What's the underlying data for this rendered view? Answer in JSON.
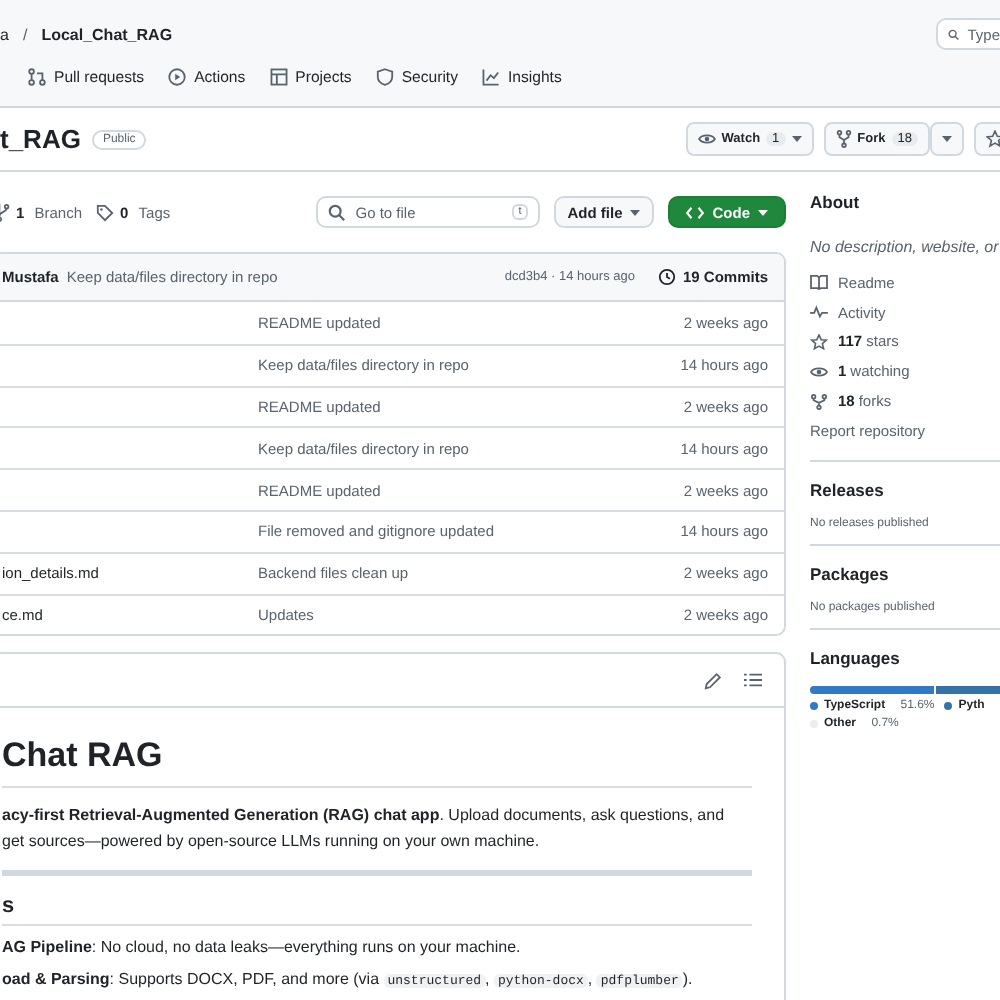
{
  "header": {
    "breadcrumb_owner": "a",
    "breadcrumb_separator": "/",
    "breadcrumb_repo": "Local_Chat_RAG",
    "search_placeholder": "Type"
  },
  "nav": [
    {
      "label": "Pull requests"
    },
    {
      "label": "Actions"
    },
    {
      "label": "Projects"
    },
    {
      "label": "Security"
    },
    {
      "label": "Insights"
    }
  ],
  "repo": {
    "name": "t_RAG",
    "visibility": "Public",
    "watch": {
      "label": "Watch",
      "count": "1"
    },
    "fork": {
      "label": "Fork",
      "count": "18"
    }
  },
  "branch_bar": {
    "branches": "1",
    "branches_label": "Branch",
    "tags": "0",
    "tags_label": "Tags",
    "go_to_file": "Go to file",
    "shortcut": "t",
    "add_file": "Add file",
    "code": "Code"
  },
  "latest_commit": {
    "author": "Mustafa",
    "message": "Keep data/files directory in repo",
    "hash_time": "dcd3b4 · 14 hours ago",
    "commits": "19 Commits"
  },
  "files": [
    {
      "message": "README updated",
      "time": "2 weeks ago"
    },
    {
      "message": "Keep data/files directory in repo",
      "time": "14 hours ago"
    },
    {
      "message": "README updated",
      "time": "2 weeks ago"
    },
    {
      "message": "Keep data/files directory in repo",
      "time": "14 hours ago"
    },
    {
      "message": "README updated",
      "time": "2 weeks ago"
    },
    {
      "message": "File removed and gitignore updated",
      "time": "14 hours ago"
    },
    {
      "name": "ion_details.md",
      "message": "Backend files clean up",
      "time": "2 weeks ago"
    },
    {
      "name": "ce.md",
      "message": "Updates",
      "time": "2 weeks ago"
    }
  ],
  "readme": {
    "title": "Chat RAG",
    "intro": "**acy-first Retrieval-Augmented Generation (RAG) chat app**. Upload documents, ask questions, and get sources—powered by open-source LLMs running on your own machine.",
    "section": "s",
    "items": [
      [
        {
          "kind": "bold",
          "text": "AG Pipeline"
        },
        {
          "kind": "text",
          "text": ": No cloud, no data leaks—everything runs on your machine."
        }
      ],
      [
        {
          "kind": "bold",
          "text": "oad & Parsing"
        },
        {
          "kind": "text",
          "text": ": Supports DOCX, PDF, and more (via "
        },
        {
          "kind": "code",
          "text": "unstructured"
        },
        {
          "kind": "text",
          "text": ", "
        },
        {
          "kind": "code",
          "text": "python-docx"
        },
        {
          "kind": "text",
          "text": ", "
        },
        {
          "kind": "code",
          "text": "pdfplumber"
        },
        {
          "kind": "text",
          "text": ")."
        }
      ]
    ]
  },
  "about": {
    "title": "About",
    "description": "No description, website, or",
    "links": [
      "Readme",
      "Activity",
      "**117** stars",
      "**1** watching",
      "**18** forks"
    ],
    "report": "Report repository"
  },
  "releases": {
    "title": "Releases",
    "note": "No releases published"
  },
  "packages": {
    "title": "Packages",
    "note": "No packages published"
  },
  "languages": {
    "title": "Languages",
    "items": [
      {
        "name": "TypeScript",
        "percent": "51.6%",
        "color": "#3178c6"
      },
      {
        "name": "Pyth",
        "color": "#3572a5"
      },
      {
        "name": "Other",
        "percent": "0.7%",
        "color": "#ededed"
      }
    ]
  }
}
